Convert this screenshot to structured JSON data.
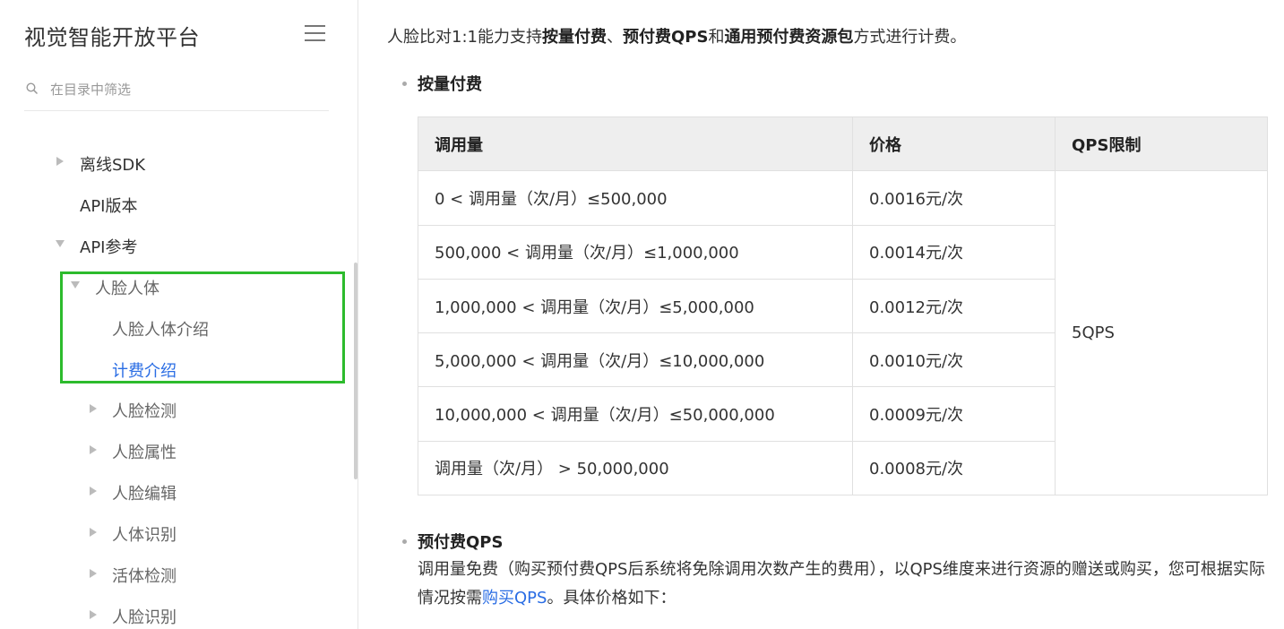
{
  "sidebar": {
    "brand": "视觉智能开放平台",
    "search_placeholder": "在目录中筛选",
    "items": [
      {
        "label": "离线SDK"
      },
      {
        "label": "API版本"
      },
      {
        "label": "API参考"
      },
      {
        "label": "人脸人体"
      },
      {
        "label": "人脸人体介绍"
      },
      {
        "label": "计费介绍"
      },
      {
        "label": "人脸检测"
      },
      {
        "label": "人脸属性"
      },
      {
        "label": "人脸编辑"
      },
      {
        "label": "人体识别"
      },
      {
        "label": "活体检测"
      },
      {
        "label": "人脸识别"
      }
    ]
  },
  "main": {
    "intro": {
      "p1": "人脸比对1:1能力支持",
      "b1": "按量付费",
      "p2": "、",
      "b2": "预付费QPS",
      "p3": "和",
      "b3": "通用预付费资源包",
      "p4": "方式进行计费。"
    },
    "section1_title": "按量付费",
    "table": {
      "headers": [
        "调用量",
        "价格",
        "QPS限制"
      ],
      "rows": [
        {
          "volume": "0 < 调用量（次/月）≤500,000",
          "price": "0.0016元/次"
        },
        {
          "volume": "500,000 < 调用量（次/月）≤1,000,000",
          "price": "0.0014元/次"
        },
        {
          "volume": "1,000,000 < 调用量（次/月）≤5,000,000",
          "price": "0.0012元/次"
        },
        {
          "volume": "5,000,000 < 调用量（次/月）≤10,000,000",
          "price": "0.0010元/次"
        },
        {
          "volume": "10,000,000 < 调用量（次/月）≤50,000,000",
          "price": "0.0009元/次"
        },
        {
          "volume": "调用量（次/月） > 50,000,000",
          "price": "0.0008元/次"
        }
      ],
      "qps_limit": "5QPS"
    },
    "section2_title": "预付费QPS",
    "section2_text": "调用量免费（购买预付费QPS后系统将免除调用次数产生的费用），以QPS维度来进行资源的赠送或购买，您可根据实际情况按需",
    "section2_link": "购买QPS",
    "section2_tail": "。具体价格如下："
  }
}
